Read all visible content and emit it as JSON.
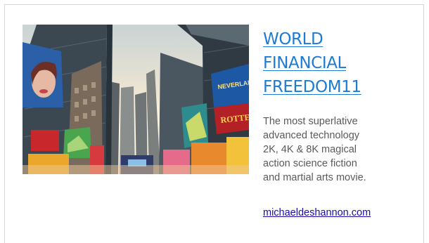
{
  "article": {
    "title_lines": [
      "WORLD",
      "FINANCIAL",
      "FREEDOM11"
    ],
    "description_lines": [
      "The most superlative",
      "advanced technology",
      "2K, 4K & 8K magical",
      "action science fiction",
      "and martial arts movie."
    ],
    "link_text": "michaeldeshannon.com"
  },
  "image": {
    "sign_texts": [
      "NEVERLAND",
      "ROTTEN"
    ]
  },
  "colors": {
    "title": "#1e7bd4",
    "description": "#5a5a5a",
    "link": "#1a0dab",
    "border": "#d6d6d6"
  }
}
